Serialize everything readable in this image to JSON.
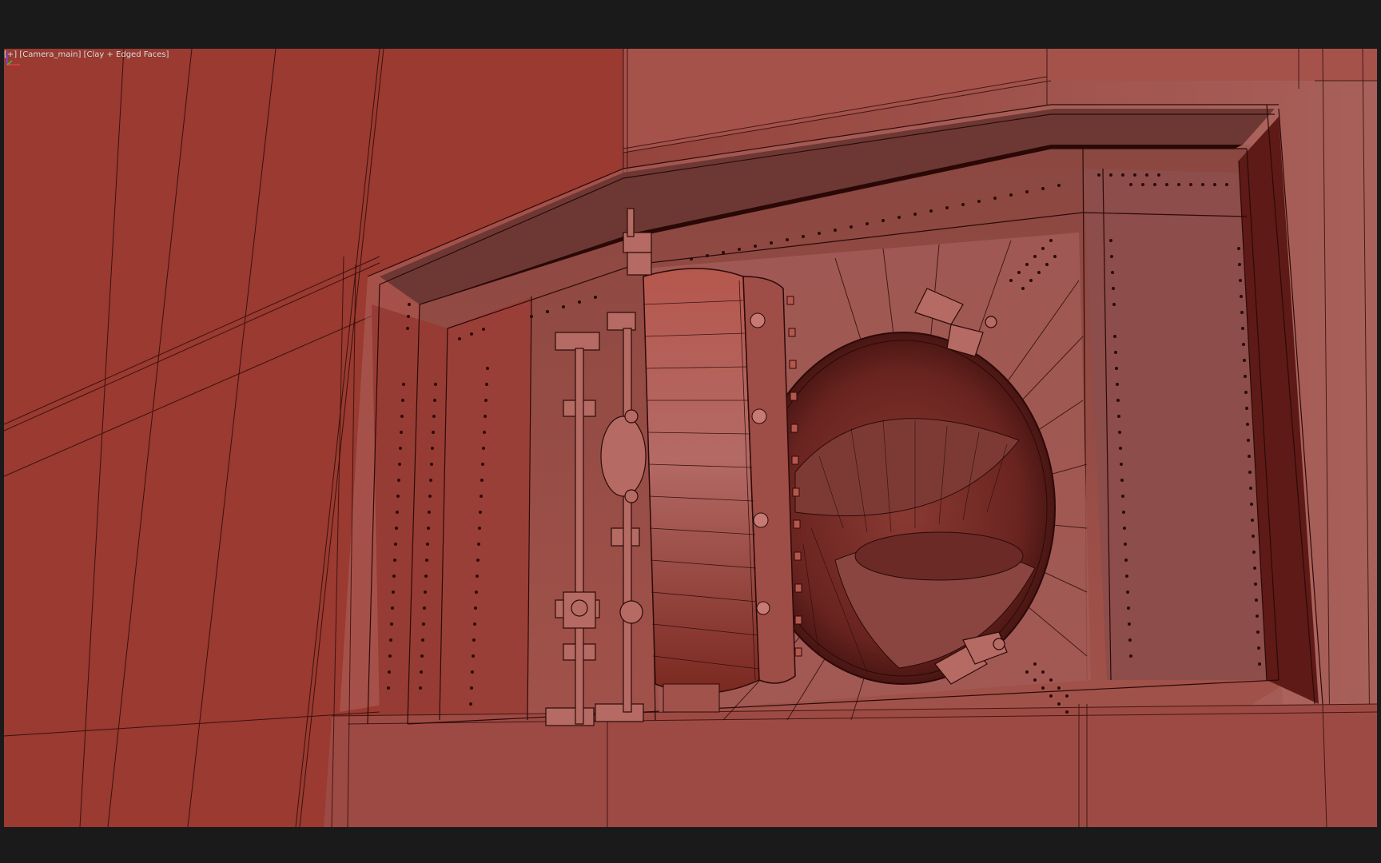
{
  "viewport": {
    "menu_plus": "[+]",
    "camera": "[Camera_main]",
    "shading": "[Clay + Edged Faces]",
    "colors": {
      "wall_left": "#9a3a30",
      "wall_right": "#a4534f",
      "recess_dark": "#2a0806",
      "frame_light": "#b06862",
      "wire": "#2b0a08",
      "background": "#1a1a1a"
    }
  },
  "scene": {
    "subject": "vault-door",
    "gizmo_axes": [
      "x-axis",
      "y-axis",
      "z-axis"
    ]
  }
}
